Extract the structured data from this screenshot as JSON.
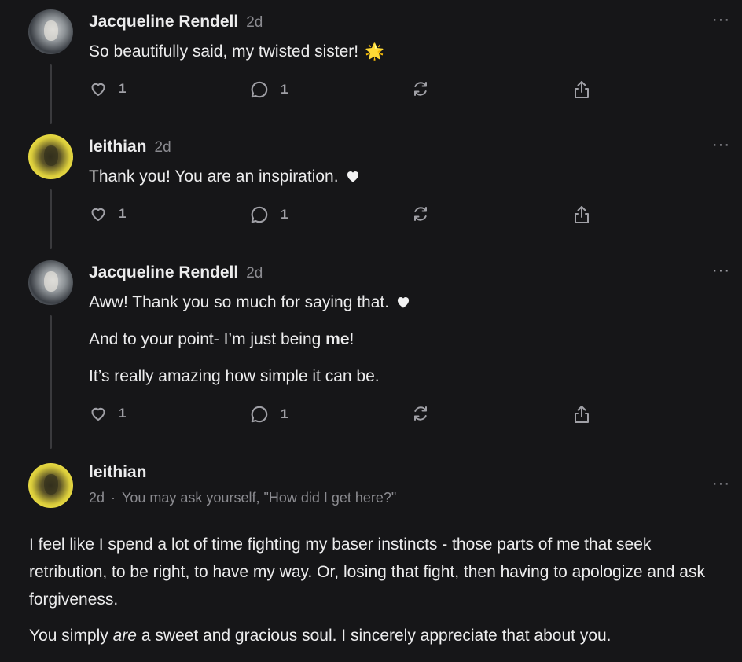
{
  "comments": [
    {
      "author": "Jacqueline Rendell",
      "time": "2d",
      "text": "So beautifully said, my twisted sister!",
      "emoji": "🌟",
      "likes": "1",
      "replies": "1"
    },
    {
      "author": "leithian",
      "time": "2d",
      "text": "Thank you! You are an inspiration.",
      "likes": "1",
      "replies": "1"
    },
    {
      "author": "Jacqueline Rendell",
      "time": "2d",
      "lines": [
        "Aww! Thank you so much for saying that.",
        "And to your point- I’m just being ",
        "me",
        "!",
        "It’s really amazing how simple it can be."
      ],
      "likes": "1",
      "replies": "1"
    },
    {
      "author": "leithian",
      "time": "2d",
      "subtitle": "You may ask yourself, \"How did I get here?\"",
      "paragraph1": "I feel like I spend a lot of time fighting my baser instincts - those parts of me that seek retribution, to be right, to have my way. Or, losing that fight, then having to apologize and ask forgiveness.",
      "paragraph2_before": "You simply ",
      "paragraph2_em": "are",
      "paragraph2_after": " a sweet and gracious soul. I sincerely appreciate that about you."
    }
  ],
  "more_label": "···",
  "icons": [
    "heart-icon",
    "comment-icon",
    "restack-icon",
    "share-icon",
    "more-icon"
  ],
  "colors": {
    "background": "#161618",
    "text": "#ececed",
    "muted": "#8b8b90",
    "thread_line": "#3a3a3d"
  }
}
